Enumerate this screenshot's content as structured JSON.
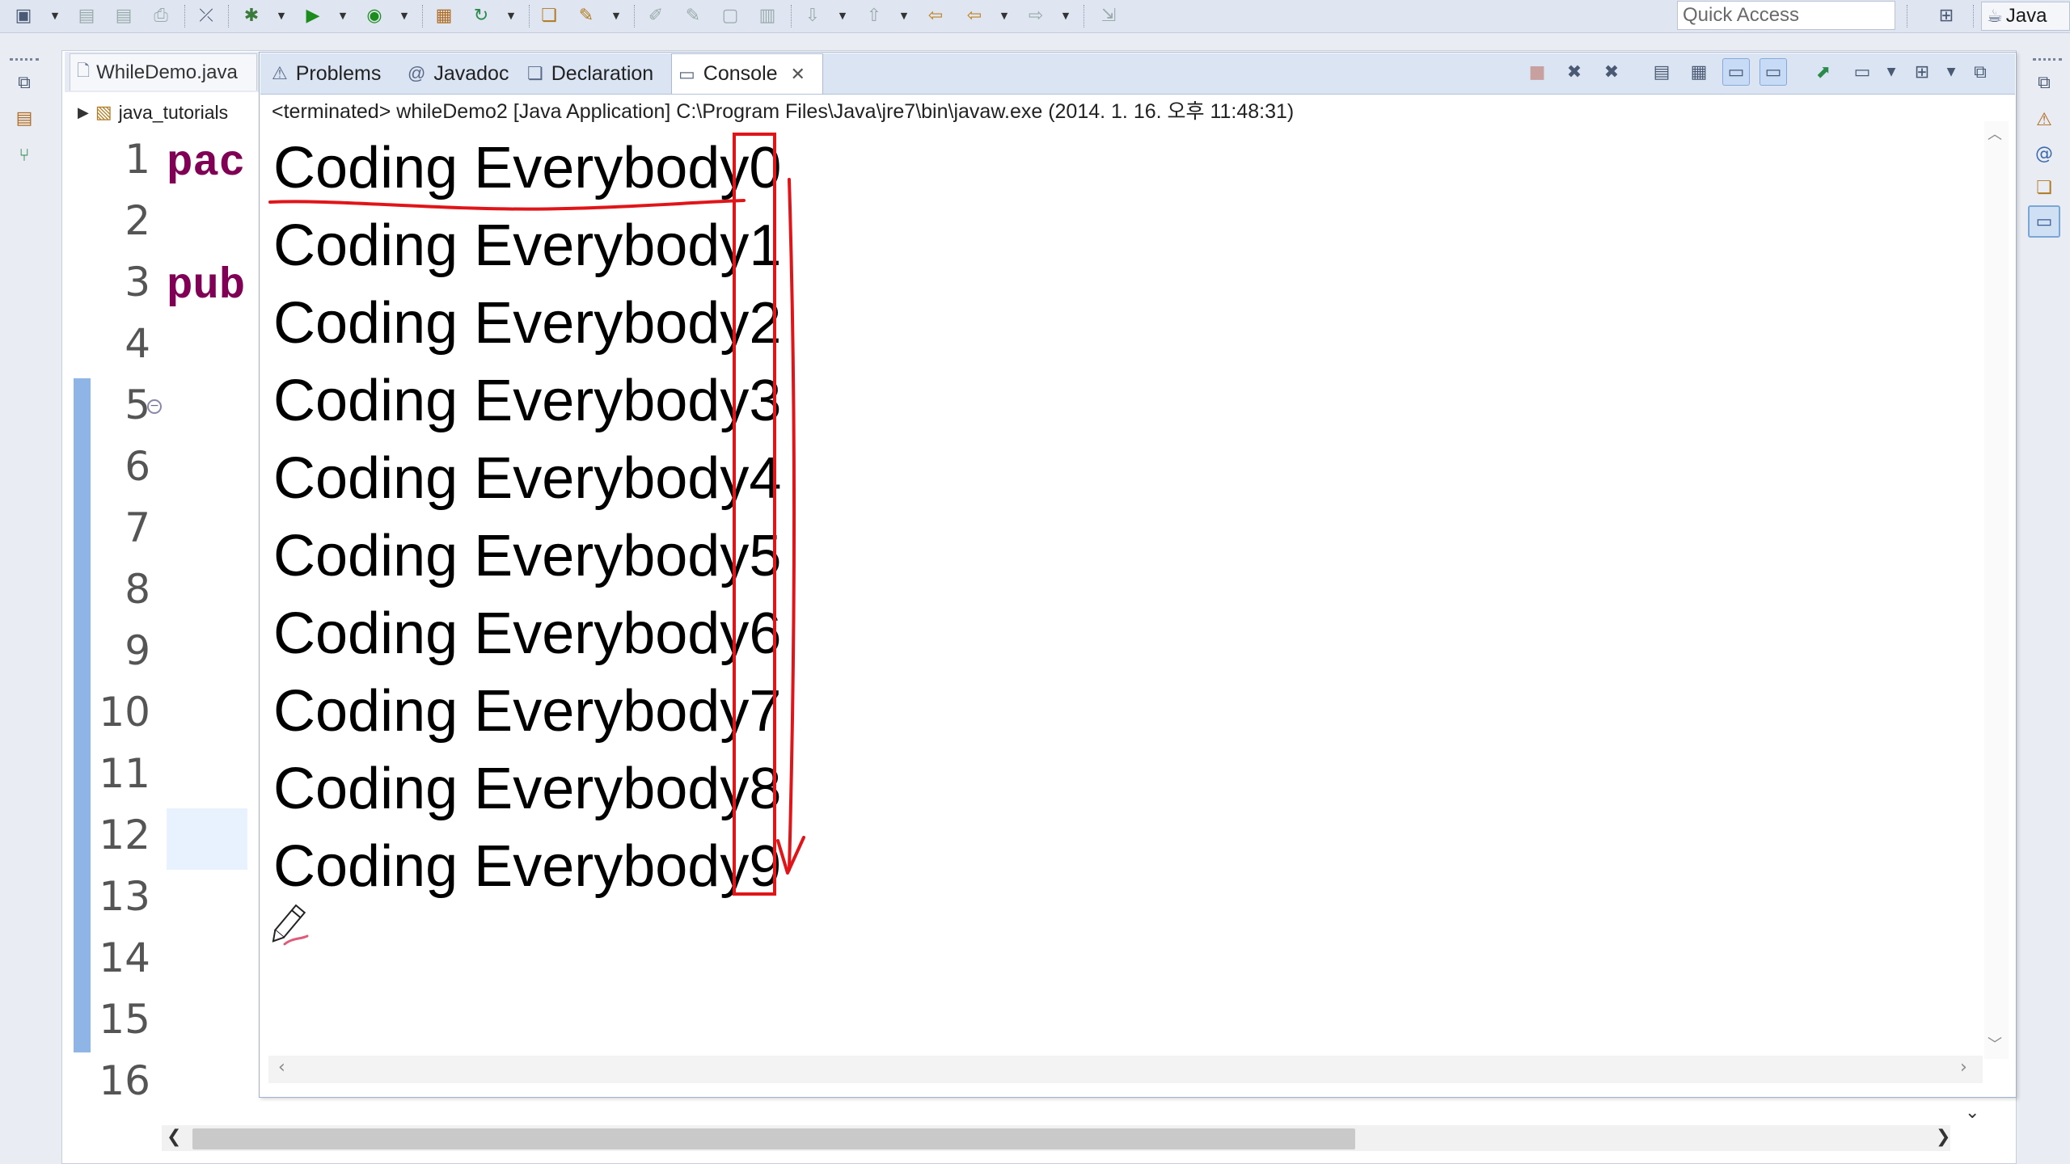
{
  "toolbar": {
    "quick_access_placeholder": "Quick Access",
    "perspective_label": "Java",
    "icons": [
      "new-icon",
      "save-icon",
      "save-all-icon",
      "print-icon",
      "skip-breakpoints-icon",
      "debug-icon",
      "run-icon",
      "coverage-icon",
      "new-java-project-icon",
      "refresh-icon",
      "open-type-icon",
      "search-icon",
      "toggle-mark-icon",
      "pin-icon",
      "show-whitespace-icon",
      "block-selection-icon",
      "next-annotation-icon",
      "prev-annotation-icon",
      "last-edit-icon",
      "back-icon",
      "forward-icon",
      "external-tools-icon",
      "open-perspective-icon",
      "java-perspective-icon"
    ]
  },
  "editor": {
    "tab_label": "WhileDemo.java",
    "tree_item_label": "java_tutorials",
    "line_numbers": [
      "1",
      "2",
      "3",
      "4",
      "5",
      "6",
      "7",
      "8",
      "9",
      "10",
      "11",
      "12",
      "13",
      "14",
      "15",
      "16"
    ],
    "code_line1": "pac",
    "code_line3": "pub"
  },
  "console": {
    "tabs": [
      {
        "label": "Problems",
        "icon": "problems-icon"
      },
      {
        "label": "Javadoc",
        "icon": "javadoc-icon"
      },
      {
        "label": "Declaration",
        "icon": "declaration-icon"
      },
      {
        "label": "Console",
        "icon": "console-icon",
        "active": true
      }
    ],
    "status": "<terminated> whileDemo2 [Java Application] C:\\Program Files\\Java\\jre7\\bin\\javaw.exe (2014. 1. 16. 오후 11:48:31)",
    "output_lines": [
      "Coding Everybody0",
      "Coding Everybody1",
      "Coding Everybody2",
      "Coding Everybody3",
      "Coding Everybody4",
      "Coding Everybody5",
      "Coding Everybody6",
      "Coding Everybody7",
      "Coding Everybody8",
      "Coding Everybody9"
    ]
  },
  "annotation": {
    "color": "#e0151a"
  }
}
